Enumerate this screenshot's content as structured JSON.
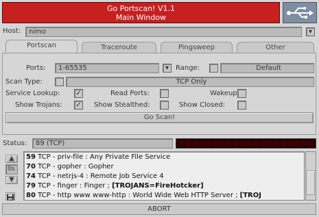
{
  "title": {
    "line1": "Go Portscan! V1.1",
    "line2": "Main Window"
  },
  "host": {
    "label": "Host:",
    "value": "nimo"
  },
  "tabs": [
    {
      "label": "Portscan"
    },
    {
      "label": "Traceroute"
    },
    {
      "label": "Pingsweep"
    },
    {
      "label": "Other"
    }
  ],
  "portscan": {
    "ports_label": "Ports:",
    "ports_value": "1-65535",
    "range_label": "Range:",
    "range_value": "Default",
    "scan_type_label": "Scan Type:",
    "scan_type_value": "TCP Only",
    "options": [
      {
        "label": "Service Lookup:",
        "checked": true
      },
      {
        "label": "Read Ports:",
        "checked": false
      },
      {
        "label": "Wakeup:",
        "checked": false
      },
      {
        "label": "Show Trojans:",
        "checked": true
      },
      {
        "label": "Show Stealthed:",
        "checked": false
      },
      {
        "label": "Show Closed:",
        "checked": false
      }
    ],
    "check_mark": "✓",
    "go_button": "Go Scan!"
  },
  "status": {
    "label": "Status:",
    "value": "89 (TCP)"
  },
  "delay": {
    "value": "0s"
  },
  "results": [
    {
      "port": "59",
      "text": " TCP - priv-file : Any Private File Service",
      "trojan": ""
    },
    {
      "port": "70",
      "text": " TCP - gopher : Gopher",
      "trojan": ""
    },
    {
      "port": "74",
      "text": " TCP - netrjs-4 : Remote Job Service 4",
      "trojan": ""
    },
    {
      "port": "79",
      "text": " TCP - finger : Finger ; ",
      "trojan": "[TROJANS=FireHotcker]"
    },
    {
      "port": "80",
      "text": " TCP - http www www-http : World Wide Web HTTP Server ; ",
      "trojan": "[TROJ"
    }
  ],
  "abort_button": "ABORT",
  "colors": {
    "title_bg": "#c62020",
    "progress_bg": "#1a0000",
    "logo_bg": "#7f8ea3"
  },
  "icons": {
    "logo": "usb-icon",
    "arrow_up": "triangle-up-icon",
    "arrow_down": "triangle-down-icon",
    "save": "floppy-icon"
  }
}
